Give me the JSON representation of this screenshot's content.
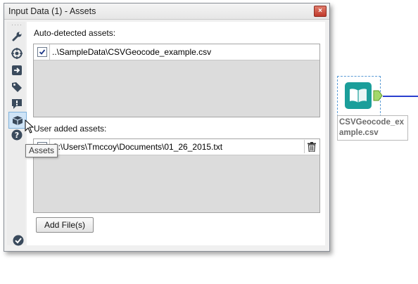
{
  "window": {
    "title": "Input Data (1) - Assets",
    "close_label": "×"
  },
  "toolbar": {
    "items": [
      {
        "icon": "wrench-icon"
      },
      {
        "icon": "target-icon"
      },
      {
        "icon": "arrow-right-icon"
      },
      {
        "icon": "tag-icon"
      },
      {
        "icon": "comment-alert-icon"
      },
      {
        "icon": "package-icon",
        "active": true
      },
      {
        "icon": "help-icon"
      }
    ],
    "ok_icon": "checkmark-icon"
  },
  "auto_detected": {
    "label": "Auto-detected assets:",
    "rows": [
      {
        "checked": true,
        "path": "..\\SampleData\\CSVGeocode_example.csv"
      }
    ]
  },
  "user_added": {
    "label": "User added assets:",
    "rows": [
      {
        "checked": true,
        "path": "C:\\Users\\Tmccoy\\Documents\\01_26_2015.txt"
      }
    ]
  },
  "add_files_button": "Add File(s)",
  "tooltip": "Assets",
  "canvas_node": {
    "label": "CSVGeocode_example.csv",
    "color": "#1b9e9a",
    "connection_color": "#2a3fcf"
  }
}
